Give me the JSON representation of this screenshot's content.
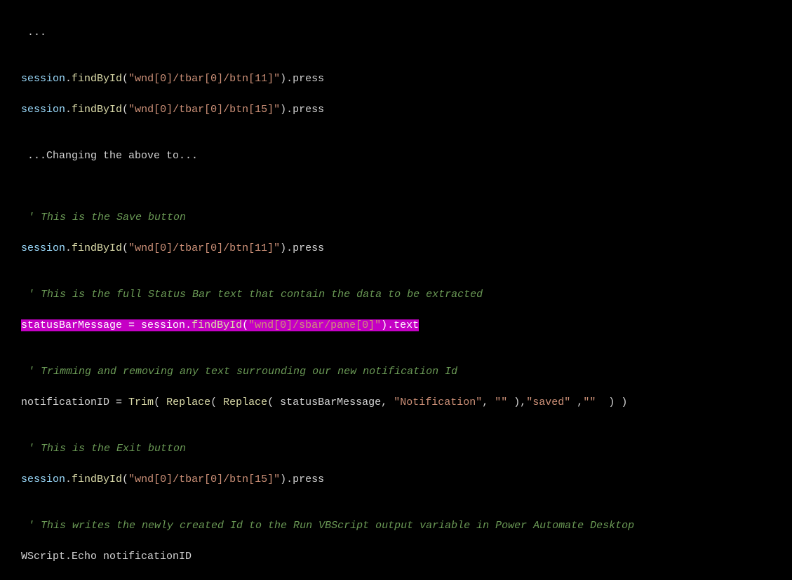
{
  "code": {
    "ellipsis1": " ...",
    "session_call_btn11_a": {
      "obj": "session",
      "method": "findById",
      "arg": "\"wnd[0]/tbar[0]/btn[11]\"",
      "tail": ".press"
    },
    "session_call_btn15_a": {
      "obj": "session",
      "method": "findById",
      "arg": "\"wnd[0]/tbar[0]/btn[15]\"",
      "tail": ".press"
    },
    "changing": " ...Changing the above to...",
    "comment_save": "' This is the Save button",
    "session_call_btn11_b": {
      "obj": "session",
      "method": "findById",
      "arg": "\"wnd[0]/tbar[0]/btn[11]\"",
      "tail": ".press"
    },
    "comment_statusbar": "' This is the full Status Bar text that contain the data to be extracted",
    "highlighted": {
      "lhs": "statusBarMessage",
      "eq": " = ",
      "obj": "session",
      "method": "findById",
      "arg": "\"wnd[0]/sbar/pane[0]\"",
      "tail": ".text"
    },
    "comment_trim": "' Trimming and removing any text surrounding our new notification Id",
    "notif_line": {
      "lhs": "notificationID",
      "eq": " = ",
      "fn_trim": "Trim",
      "open1": "( ",
      "fn_replace1": "Replace",
      "open2": "( ",
      "fn_replace2": "Replace",
      "open3": "( ",
      "arg1": "statusBarMessage",
      "comma1": ", ",
      "str_notif": "\"Notification\"",
      "comma2": ", ",
      "str_empty1": "\"\"",
      "close1": " )",
      "comma3": ",",
      "str_saved": "\"saved\"",
      "comma4": " ,",
      "str_empty2": "\"\"",
      "close2": "  )",
      "close3": " )"
    },
    "comment_exit": "' This is the Exit button",
    "session_call_btn15_b": {
      "obj": "session",
      "method": "findById",
      "arg": "\"wnd[0]/tbar[0]/btn[15]\"",
      "tail": ".press"
    },
    "comment_wscript": "' This writes the newly created Id to the Run VBScript output variable in Power Automate Desktop",
    "wscript_line": "WScript.Echo notificationID"
  }
}
